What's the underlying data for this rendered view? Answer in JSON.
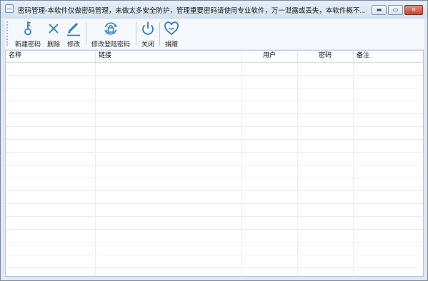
{
  "window": {
    "title": "密码管理-本软件仅做密码管理，未做太多安全防护，管理重要密码请使用专业软件，万一泄露或丢失，本软件概不...",
    "controls": {
      "minimize": "▬",
      "maximize": "▭",
      "close": "✕"
    }
  },
  "toolbar": {
    "buttons": [
      {
        "label": "新建密码",
        "icon": "key-icon"
      },
      {
        "label": "删除",
        "icon": "close-x-icon"
      },
      {
        "label": "修改",
        "icon": "pencil-icon"
      },
      {
        "label": "修改登陆密码",
        "icon": "lock-refresh-icon"
      },
      {
        "label": "关闭",
        "icon": "power-icon"
      },
      {
        "label": "捐赠",
        "icon": "heart-icon"
      }
    ]
  },
  "table": {
    "columns": [
      "名称",
      "链接",
      "用户",
      "密码",
      "备注"
    ],
    "rows": []
  },
  "colors": {
    "accent": "#2e7cc6",
    "titlebar": "#d9e5f2",
    "close": "#c7432f"
  }
}
